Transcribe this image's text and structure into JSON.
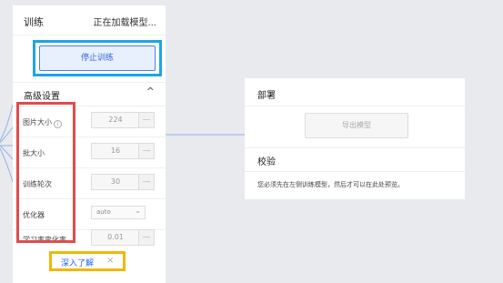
{
  "training": {
    "title": "训练",
    "status": "正在加载模型...",
    "stop_button": "停止训练"
  },
  "advanced": {
    "title": "高级设置",
    "chevron": "chevron-up-icon",
    "fields": [
      {
        "label": "图片大小",
        "value": "224"
      },
      {
        "label": "批大小",
        "value": "16"
      },
      {
        "label": "训练轮次",
        "value": "30"
      },
      {
        "label": "优化器",
        "value": "auto"
      },
      {
        "label": "学习率变化率",
        "value": "0.01"
      }
    ]
  },
  "learn_more": {
    "label": "深入了解",
    "close": "×"
  },
  "deploy": {
    "title": "部署",
    "export_button": "导出模型"
  },
  "verify": {
    "title": "校验",
    "message": "您必须先在左侧训练模型，然后才可以在此处预览。"
  },
  "colors": {
    "highlight_blue": "#1ea4e8",
    "highlight_red": "#e24b4b",
    "highlight_yellow": "#f2b705",
    "link_blue": "#1e62ff"
  }
}
